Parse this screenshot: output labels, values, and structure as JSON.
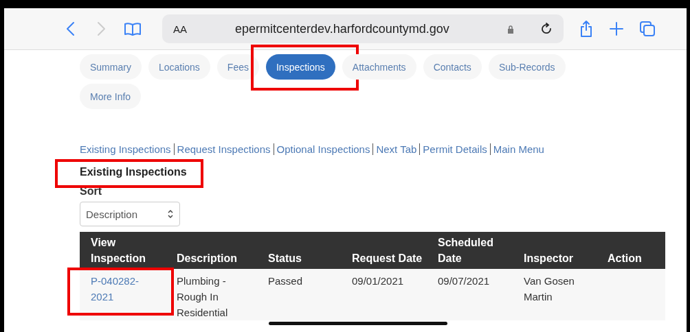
{
  "browser": {
    "text_size": "AA",
    "url": "epermitcenterdev.harfordcountymd.gov"
  },
  "tabs": [
    {
      "label": "Summary",
      "selected": false,
      "highlighted": false
    },
    {
      "label": "Locations",
      "selected": false,
      "highlighted": false
    },
    {
      "label": "Fees",
      "selected": false,
      "highlighted": false
    },
    {
      "label": "Inspections",
      "selected": true,
      "highlighted": true
    },
    {
      "label": "Attachments",
      "selected": false,
      "highlighted": false
    },
    {
      "label": "Contacts",
      "selected": false,
      "highlighted": false
    },
    {
      "label": "Sub-Records",
      "selected": false,
      "highlighted": false
    },
    {
      "label": "More Info",
      "selected": false,
      "highlighted": false
    }
  ],
  "links": [
    "Existing Inspections",
    "Request Inspections",
    "Optional Inspections",
    "Next Tab",
    "Permit Details",
    "Main Menu"
  ],
  "heading": {
    "text": "Existing Inspections",
    "highlighted": true
  },
  "sort": {
    "label": "Sort",
    "value": "Description"
  },
  "table": {
    "columns": [
      "View Inspection",
      "Description",
      "Status",
      "Request Date",
      "Scheduled Date",
      "Inspector",
      "Action"
    ],
    "rows": [
      {
        "highlighted": true,
        "cells": [
          "P-040282-2021",
          "Plumbing - Rough In Residential",
          "Passed",
          "09/01/2021",
          "09/07/2021",
          "Van Gosen Martin",
          ""
        ]
      }
    ]
  }
}
